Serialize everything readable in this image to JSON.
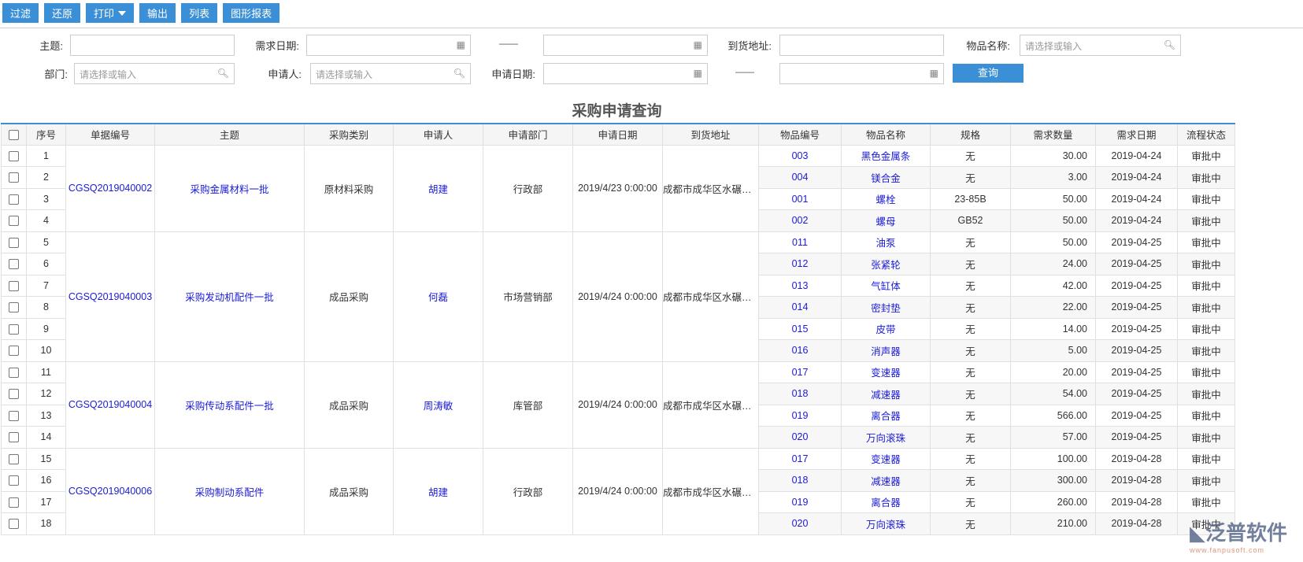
{
  "toolbar": {
    "filter": "过滤",
    "reset": "还原",
    "print": "打印",
    "export": "输出",
    "list": "列表",
    "chart": "图形报表"
  },
  "filters": {
    "subject": "主题:",
    "demand_date": "需求日期:",
    "address": "到货地址:",
    "item_name": "物品名称:",
    "dept": "部门:",
    "applicant": "申请人:",
    "apply_date": "申请日期:",
    "placeholder": "请选择或输入",
    "dash": "——",
    "query": "查询"
  },
  "page_title": "采购申请查询",
  "columns": [
    "序号",
    "单据编号",
    "主题",
    "采购类别",
    "申请人",
    "申请部门",
    "申请日期",
    "到货地址",
    "物品编号",
    "物品名称",
    "规格",
    "需求数量",
    "需求日期",
    "流程状态"
  ],
  "groups": [
    {
      "no": "CGSQ2019040002",
      "subject": "采购金属材料一批",
      "type": "原材料采购",
      "applicant": "胡建",
      "dept": "行政部",
      "date": "2019/4/23 0:00:00",
      "address": "成都市成华区水碾河路",
      "items": [
        {
          "seq": "1",
          "code": "003",
          "name": "黑色金属条",
          "spec": "无",
          "qty": "30.00",
          "need": "2019-04-24",
          "status": "审批中"
        },
        {
          "seq": "2",
          "code": "004",
          "name": "镁合金",
          "spec": "无",
          "qty": "3.00",
          "need": "2019-04-24",
          "status": "审批中"
        },
        {
          "seq": "3",
          "code": "001",
          "name": "螺栓",
          "spec": "23-85B",
          "qty": "50.00",
          "need": "2019-04-24",
          "status": "审批中"
        },
        {
          "seq": "4",
          "code": "002",
          "name": "螺母",
          "spec": "GB52",
          "qty": "50.00",
          "need": "2019-04-24",
          "status": "审批中"
        }
      ]
    },
    {
      "no": "CGSQ2019040003",
      "subject": "采购发动机配件一批",
      "type": "成品采购",
      "applicant": "何磊",
      "dept": "市场营销部",
      "date": "2019/4/24 0:00:00",
      "address": "成都市成华区水碾河路",
      "items": [
        {
          "seq": "5",
          "code": "011",
          "name": "油泵",
          "spec": "无",
          "qty": "50.00",
          "need": "2019-04-25",
          "status": "审批中"
        },
        {
          "seq": "6",
          "code": "012",
          "name": "张紧轮",
          "spec": "无",
          "qty": "24.00",
          "need": "2019-04-25",
          "status": "审批中"
        },
        {
          "seq": "7",
          "code": "013",
          "name": "气缸体",
          "spec": "无",
          "qty": "42.00",
          "need": "2019-04-25",
          "status": "审批中"
        },
        {
          "seq": "8",
          "code": "014",
          "name": "密封垫",
          "spec": "无",
          "qty": "22.00",
          "need": "2019-04-25",
          "status": "审批中"
        },
        {
          "seq": "9",
          "code": "015",
          "name": "皮带",
          "spec": "无",
          "qty": "14.00",
          "need": "2019-04-25",
          "status": "审批中"
        },
        {
          "seq": "10",
          "code": "016",
          "name": "消声器",
          "spec": "无",
          "qty": "5.00",
          "need": "2019-04-25",
          "status": "审批中"
        }
      ]
    },
    {
      "no": "CGSQ2019040004",
      "subject": "采购传动系配件一批",
      "type": "成品采购",
      "applicant": "周涛敏",
      "dept": "库管部",
      "date": "2019/4/24 0:00:00",
      "address": "成都市成华区水碾河路",
      "items": [
        {
          "seq": "11",
          "code": "017",
          "name": "变速器",
          "spec": "无",
          "qty": "20.00",
          "need": "2019-04-25",
          "status": "审批中"
        },
        {
          "seq": "12",
          "code": "018",
          "name": "减速器",
          "spec": "无",
          "qty": "54.00",
          "need": "2019-04-25",
          "status": "审批中"
        },
        {
          "seq": "13",
          "code": "019",
          "name": "离合器",
          "spec": "无",
          "qty": "566.00",
          "need": "2019-04-25",
          "status": "审批中"
        },
        {
          "seq": "14",
          "code": "020",
          "name": "万向滚珠",
          "spec": "无",
          "qty": "57.00",
          "need": "2019-04-25",
          "status": "审批中"
        }
      ]
    },
    {
      "no": "CGSQ2019040006",
      "subject": "采购制动系配件",
      "type": "成品采购",
      "applicant": "胡建",
      "dept": "行政部",
      "date": "2019/4/24 0:00:00",
      "address": "成都市成华区水碾河路",
      "items": [
        {
          "seq": "15",
          "code": "017",
          "name": "变速器",
          "spec": "无",
          "qty": "100.00",
          "need": "2019-04-28",
          "status": "审批中"
        },
        {
          "seq": "16",
          "code": "018",
          "name": "减速器",
          "spec": "无",
          "qty": "300.00",
          "need": "2019-04-28",
          "status": "审批中"
        },
        {
          "seq": "17",
          "code": "019",
          "name": "离合器",
          "spec": "无",
          "qty": "260.00",
          "need": "2019-04-28",
          "status": "审批中"
        },
        {
          "seq": "18",
          "code": "020",
          "name": "万向滚珠",
          "spec": "无",
          "qty": "210.00",
          "need": "2019-04-28",
          "status": "审批中"
        }
      ]
    }
  ],
  "watermark": {
    "name": "泛普软件",
    "url": "www.fanpusoft.com"
  }
}
